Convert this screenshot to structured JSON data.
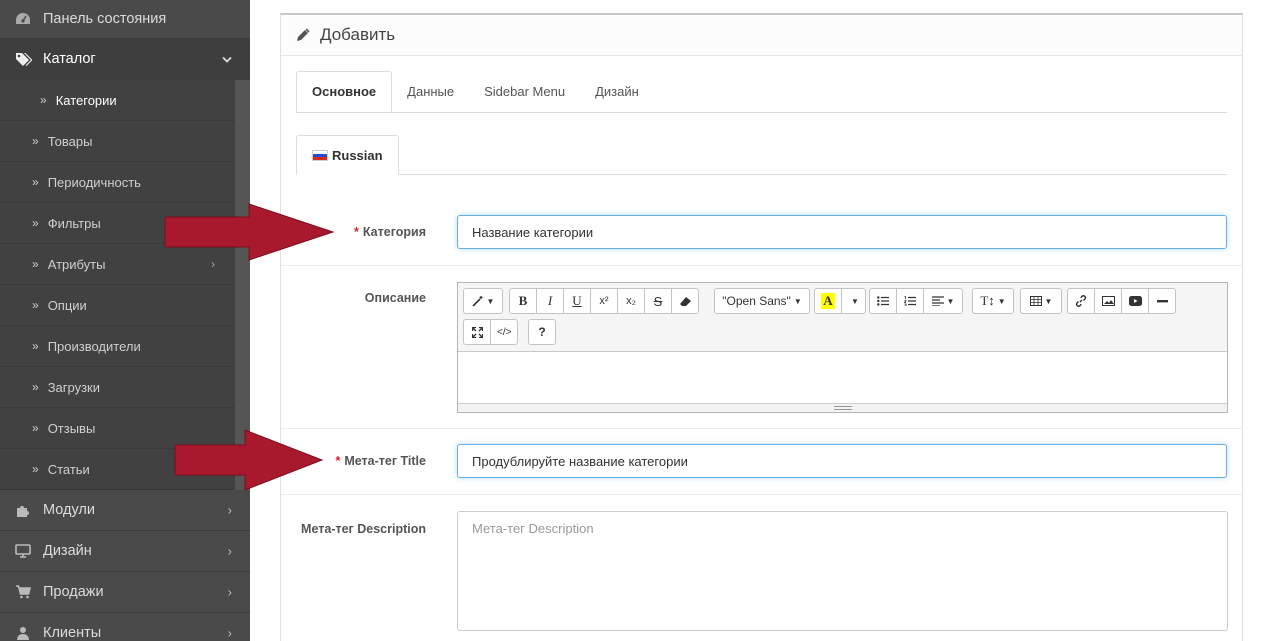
{
  "sidebar": {
    "dashboard": "Панель состояния",
    "catalog": "Каталог",
    "catalog_items": [
      "Категории",
      "Товары",
      "Периодичность",
      "Фильтры",
      "Атрибуты",
      "Опции",
      "Производители",
      "Загрузки",
      "Отзывы",
      "Статьи"
    ],
    "modules": "Модули",
    "design": "Дизайн",
    "sales": "Продажи",
    "clients": "Клиенты"
  },
  "panel": {
    "title": "Добавить",
    "tabs": [
      "Основное",
      "Данные",
      "Sidebar Menu",
      "Дизайн"
    ],
    "language_tab": "Russian"
  },
  "form": {
    "category_label": "Категория",
    "category_value": "Название категории",
    "description_label": "Описание",
    "meta_title_label": "Мета-тег Title",
    "meta_title_value": "Продублируйте название категории",
    "meta_description_label": "Мета-тег Description",
    "meta_description_placeholder": "Мета-тег Description"
  },
  "editor": {
    "font_select": "\"Open Sans\"",
    "help_label": "?"
  },
  "colors": {
    "sidebar_bg": "#4a4a4a",
    "required_star": "#e02222",
    "arrow": "#a8192e",
    "focus_border": "#66afe9"
  }
}
